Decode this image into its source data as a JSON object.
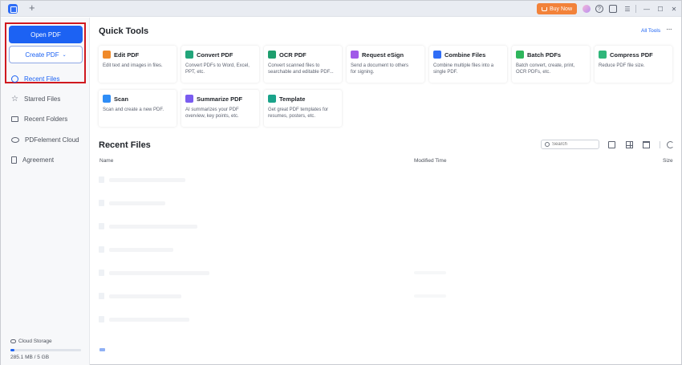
{
  "titlebar": {
    "new_tab": "+",
    "buy_now": "Buy Now",
    "help_icon": "?",
    "chat_icon": "☐",
    "menu_icon": "☰",
    "minimize_icon": "—",
    "maximize_icon": "☐",
    "close_icon": "✕"
  },
  "sidebar": {
    "open_pdf": "Open PDF",
    "create_pdf": "Create PDF",
    "create_chevron": "⌄",
    "items": [
      {
        "label": "Recent Files",
        "icon": "clock-icon",
        "active": true
      },
      {
        "label": "Starred Files",
        "icon": "star-icon"
      },
      {
        "label": "Recent Folders",
        "icon": "folder-icon"
      },
      {
        "label": "PDFelement Cloud",
        "icon": "cloud-icon"
      },
      {
        "label": "Agreement",
        "icon": "document-icon"
      }
    ],
    "storage": {
      "label": "Cloud Storage",
      "usage": "285.1 MB / 5 GB",
      "fraction_used": 0.057
    }
  },
  "quick_tools": {
    "title": "Quick Tools",
    "all_tools": "All Tools",
    "more": "···",
    "cards": [
      {
        "title": "Edit PDF",
        "desc": "Edit text and images in files.",
        "color": "#f08a2a",
        "icon": "edit-icon"
      },
      {
        "title": "Convert PDF",
        "desc": "Convert PDFs to Word, Excel,\nPPT, etc.",
        "color": "#22a57a",
        "icon": "convert-icon"
      },
      {
        "title": "OCR PDF",
        "desc": "Convert scanned files to\nsearchable and editable PDF...",
        "color": "#1e9e6e",
        "icon": "ocr-icon"
      },
      {
        "title": "Request eSign",
        "desc": "Send a document to others\nfor signing.",
        "color": "#a15ae8",
        "icon": "esign-icon"
      },
      {
        "title": "Combine Files",
        "desc": "Combine multiple files into a\nsingle PDF.",
        "color": "#2f6df6",
        "icon": "combine-icon"
      },
      {
        "title": "Batch PDFs",
        "desc": "Batch convert, create, print,\nOCR PDFs, etc.",
        "color": "#2fb65c",
        "icon": "batch-icon"
      },
      {
        "title": "Compress PDF",
        "desc": "Reduce PDF file size.",
        "color": "#2fb67a",
        "icon": "compress-icon"
      },
      {
        "title": "Scan",
        "desc": "Scan and create a new PDF.",
        "color": "#2f8df6",
        "icon": "scan-icon"
      },
      {
        "title": "Summarize PDF",
        "desc": "AI summarizes your PDF\noverview, key points, etc.",
        "color": "#7a5cf0",
        "icon": "summarize-icon"
      },
      {
        "title": "Template",
        "desc": "Get great PDF templates for\nresumes, posters, etc.",
        "color": "#1aa38a",
        "icon": "template-icon"
      }
    ]
  },
  "recent_files": {
    "title": "Recent Files",
    "search_placeholder": "Search",
    "columns": {
      "name": "Name",
      "modified": "Modified Time",
      "size": "Size"
    }
  }
}
